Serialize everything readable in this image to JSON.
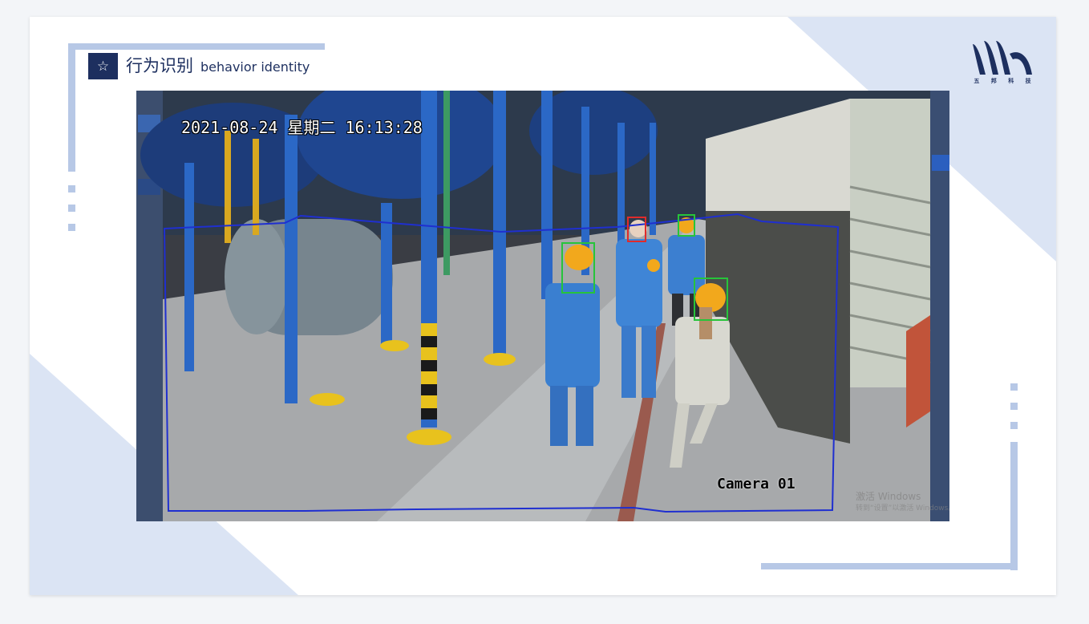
{
  "slide": {
    "title_cn": "行为识别",
    "title_en": "behavior identity",
    "badge_icon": "star-icon",
    "colors": {
      "navy": "#1d2f5f",
      "deco_light": "#dbe4f4",
      "deco_line": "#b7c8e6"
    }
  },
  "logo": {
    "icon": "company-logo",
    "text": "五 邦 科 技"
  },
  "video": {
    "timestamp": "2021-08-24 星期二 16:13:28",
    "camera_label": "Camera 01",
    "watermark_line1": "激活 Windows",
    "watermark_line2": "转到“设置”以激活 Windows。",
    "detections": [
      {
        "label": "helmet-detected",
        "color": "#27c43a"
      },
      {
        "label": "no-helmet-detected",
        "color": "#e02b2b"
      },
      {
        "label": "helmet-detected",
        "color": "#27c43a"
      },
      {
        "label": "helmet-detected",
        "color": "#27c43a"
      }
    ],
    "roi_color": "#1f2fd0"
  }
}
